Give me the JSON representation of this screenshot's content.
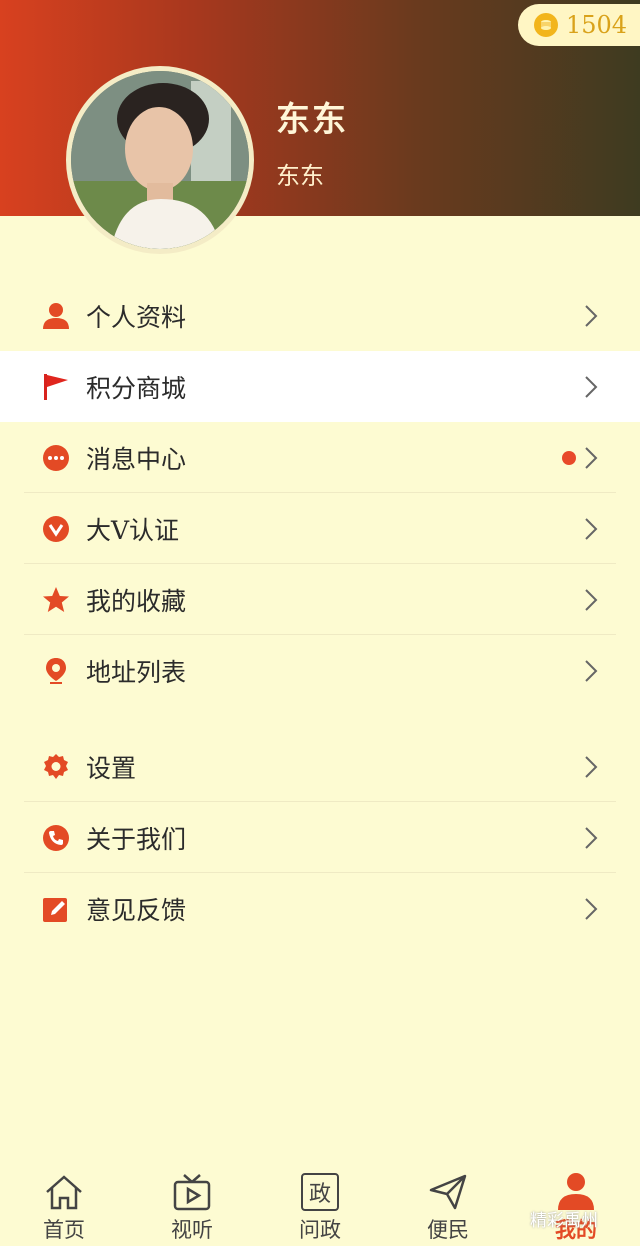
{
  "profile": {
    "name": "东东",
    "nickname": "东东",
    "points": "1504",
    "avatar_icon": "user-avatar-photo"
  },
  "menu_group_1": [
    {
      "label": "个人资料",
      "icon": "person-icon"
    },
    {
      "label": "积分商城",
      "icon": "flag-icon"
    },
    {
      "label": "消息中心",
      "icon": "message-icon",
      "has_dot": true
    },
    {
      "label": "大V认证",
      "icon": "verified-v-icon"
    },
    {
      "label": "我的收藏",
      "icon": "star-icon"
    },
    {
      "label": "地址列表",
      "icon": "location-pin-icon"
    }
  ],
  "menu_group_2": [
    {
      "label": "设置",
      "icon": "gear-icon"
    },
    {
      "label": "关于我们",
      "icon": "phone-icon"
    },
    {
      "label": "意见反馈",
      "icon": "edit-icon"
    }
  ],
  "tabbar": [
    {
      "label": "首页",
      "icon": "home-icon"
    },
    {
      "label": "视听",
      "icon": "tv-play-icon"
    },
    {
      "label": "问政",
      "icon": "zheng-icon",
      "glyph": "政"
    },
    {
      "label": "便民",
      "icon": "send-icon"
    },
    {
      "label": "我的",
      "icon": "me-icon",
      "active": true
    }
  ],
  "watermark": "精彩禹州",
  "colors": {
    "accent": "#e34a25",
    "background": "#fdfbd2",
    "header_start": "#d8411f",
    "header_end": "#3e3b20",
    "coin": "#f2b51c"
  }
}
